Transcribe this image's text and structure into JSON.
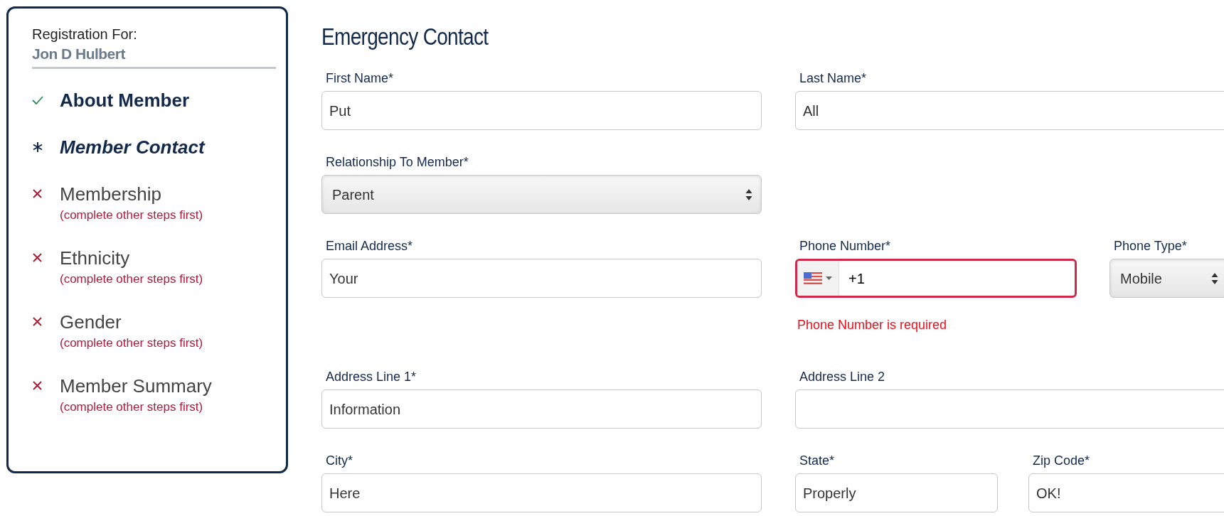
{
  "sidebar": {
    "label": "Registration For:",
    "name": "Jon D Hulbert",
    "steps": [
      {
        "label": "About Member",
        "kind": "done"
      },
      {
        "label": "Member Contact",
        "kind": "current"
      },
      {
        "label": "Membership",
        "kind": "blocked",
        "note": "(complete other steps first)"
      },
      {
        "label": "Ethnicity",
        "kind": "blocked",
        "note": "(complete other steps first)"
      },
      {
        "label": "Gender",
        "kind": "blocked",
        "note": "(complete other steps first)"
      },
      {
        "label": "Member Summary",
        "kind": "blocked",
        "note": "(complete other steps first)"
      }
    ]
  },
  "form": {
    "title": "Emergency Contact",
    "rows": [
      {
        "fields": [
          {
            "kind": "text",
            "label": "First Name*",
            "value": "Put"
          },
          {
            "kind": "text",
            "label": "Last Name*",
            "value": "All"
          }
        ]
      },
      {
        "fields": [
          {
            "kind": "select",
            "label": "Relationship To Member*",
            "value": "Parent"
          }
        ]
      },
      {
        "fields": [
          {
            "kind": "text",
            "label": "Email Address*",
            "value": "Your"
          },
          {
            "kind": "phone",
            "label": "Phone Number*",
            "value": "+1",
            "invalid": true,
            "error": "Phone Number is required"
          },
          {
            "kind": "select",
            "label": "Phone Type*",
            "value": "Mobile"
          }
        ]
      },
      {
        "fields": [
          {
            "kind": "text",
            "label": "Address Line 1*",
            "value": "Information"
          },
          {
            "kind": "text",
            "label": "Address Line 2"
          }
        ]
      },
      {
        "fields": [
          {
            "kind": "text",
            "label": "City*",
            "value": "Here"
          },
          {
            "kind": "text",
            "label": "State*",
            "value": "Properly"
          },
          {
            "kind": "text",
            "label": "Zip Code*",
            "value": "OK!"
          }
        ]
      }
    ]
  }
}
